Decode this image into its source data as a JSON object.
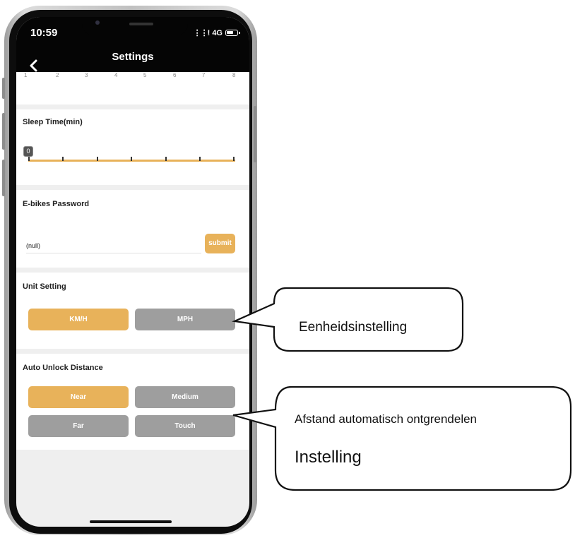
{
  "status_bar": {
    "time": "10:59",
    "network": "4G"
  },
  "nav": {
    "title": "Settings",
    "back_icon": "chevron-left-icon"
  },
  "scale_ticks": [
    "1",
    "2",
    "3",
    "4",
    "5",
    "6",
    "7",
    "8"
  ],
  "sleep_time": {
    "title": "Sleep Time(min)",
    "value": "0",
    "level": 0
  },
  "password": {
    "title": "E-bikes Password",
    "value": "(null)",
    "submit_label": "submit"
  },
  "unit_setting": {
    "title": "Unit Setting",
    "options": [
      "KM/H",
      "MPH"
    ],
    "selected": "KM/H"
  },
  "auto_unlock": {
    "title": "Auto Unlock Distance",
    "options": [
      "Near",
      "Medium",
      "Far",
      "Touch"
    ],
    "selected": "Near"
  },
  "callouts": {
    "unit": "Eenheidsinstelling",
    "distance_line1": "Afstand automatisch ontgrendelen",
    "distance_line2": "Instelling"
  },
  "colors": {
    "accent": "#e8b25a",
    "inactive": "#9e9e9e",
    "topbar": "#050505"
  }
}
